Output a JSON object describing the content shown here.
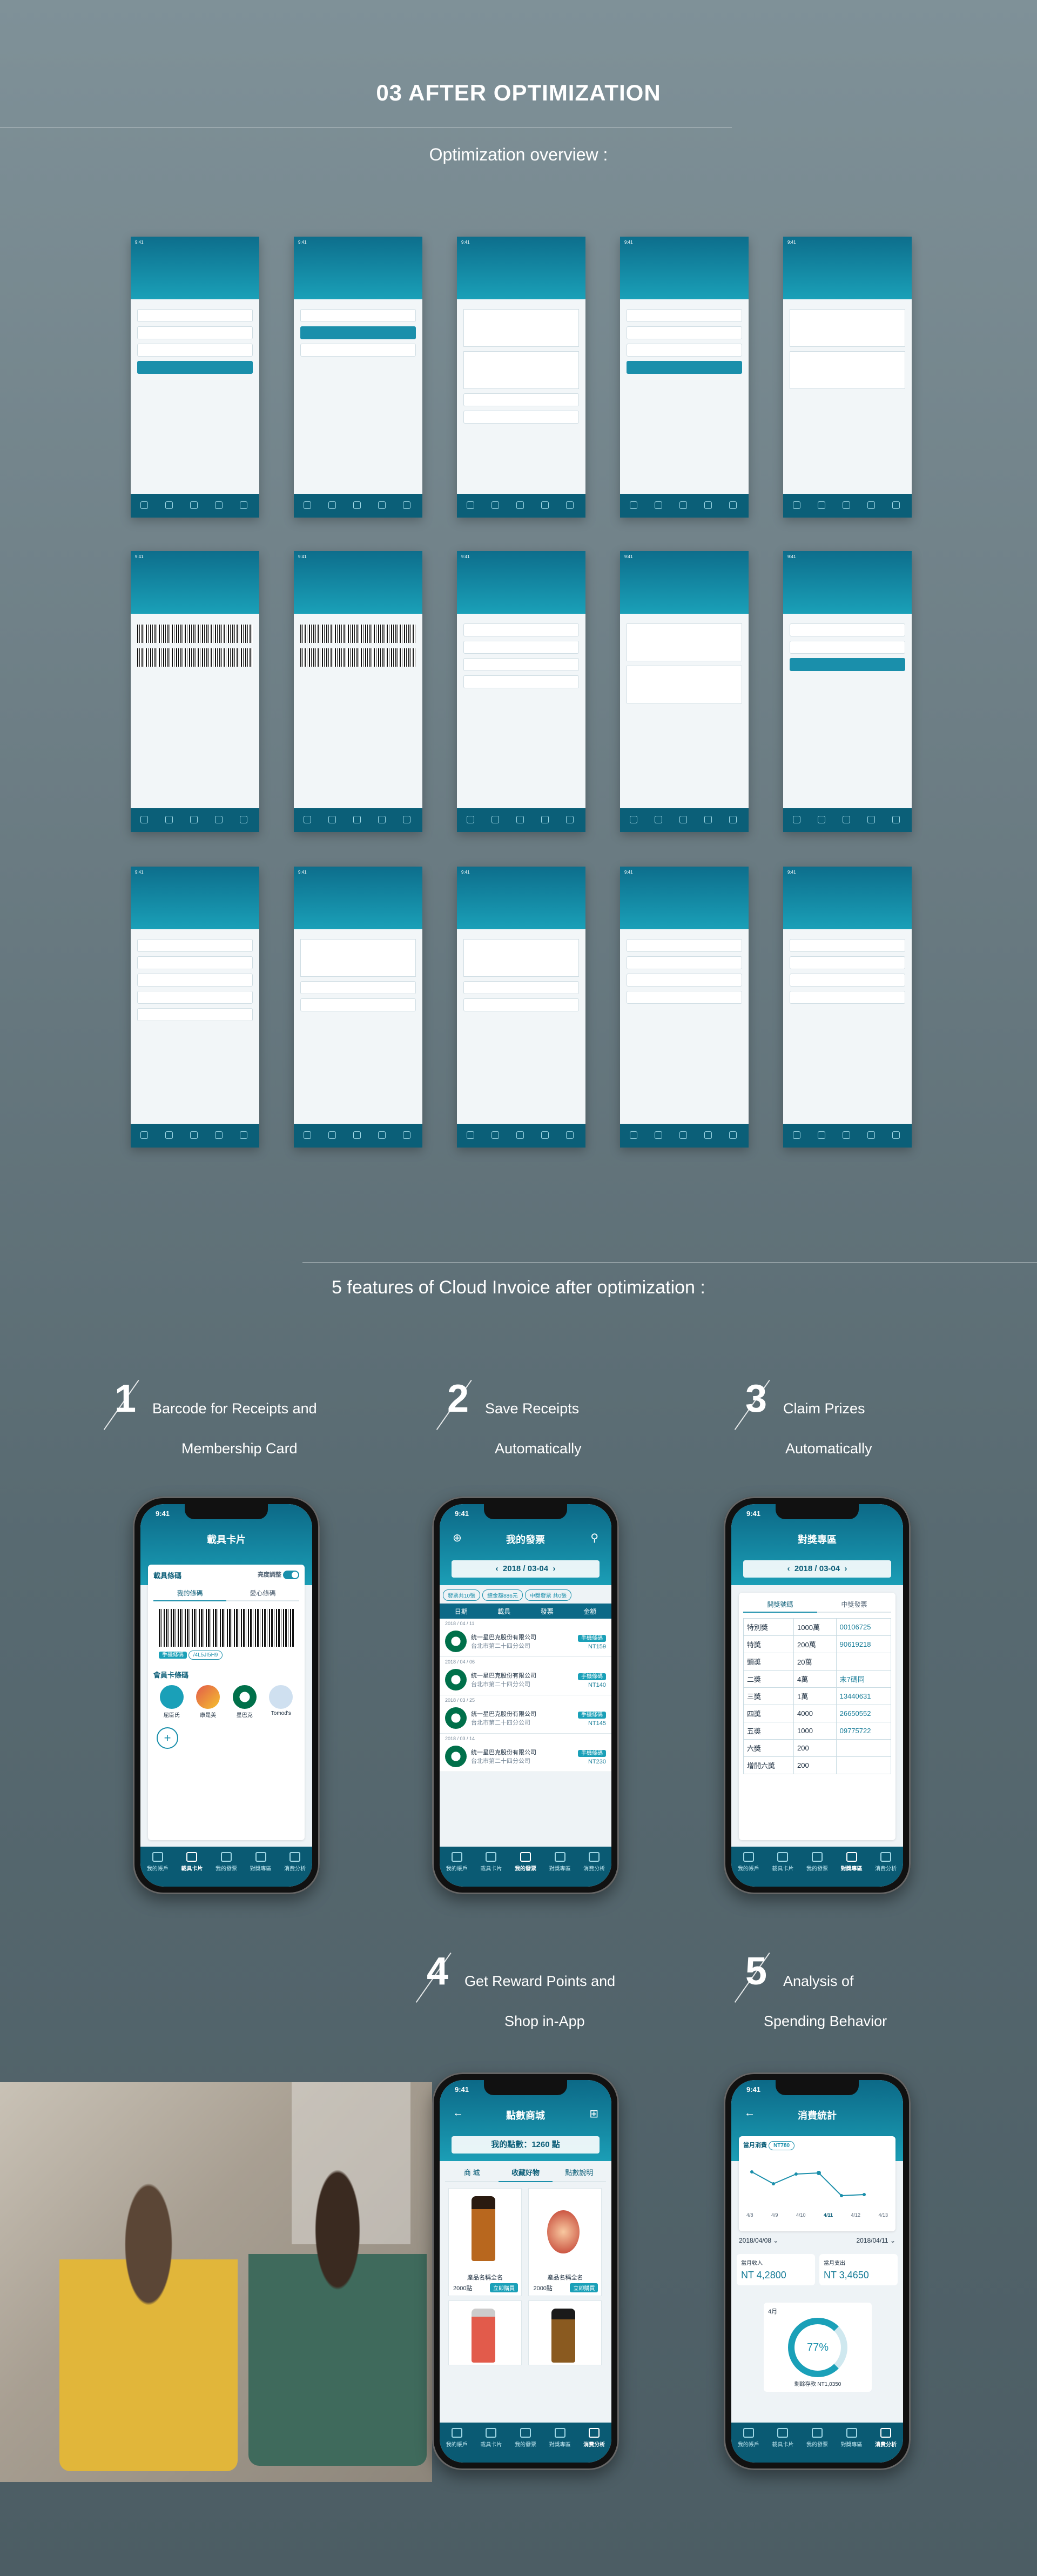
{
  "page": {
    "title": "03 AFTER OPTIMIZATION",
    "overview_label": "Optimization overview :",
    "features_heading": "5 features of Cloud Invoice after optimization :"
  },
  "features": [
    {
      "num": "1",
      "line1": "Barcode for Receipts and",
      "line2": "Membership Card"
    },
    {
      "num": "2",
      "line1": "Save Receipts",
      "line2": "Automatically"
    },
    {
      "num": "3",
      "line1": "Claim Prizes",
      "line2": "Automatically"
    },
    {
      "num": "4",
      "line1": "Get Reward Points and",
      "line2": "Shop  in-App"
    },
    {
      "num": "5",
      "line1": "Analysis of",
      "line2": "Spending Behavior"
    }
  ],
  "status_time": "9:41",
  "tabbar": [
    "我的帳戶",
    "載具卡片",
    "我的發票",
    "對獎專區",
    "消費分析"
  ],
  "phone1": {
    "title": "載具卡片",
    "carrier_label": "載具條碼",
    "toggle_label": "亮度調整",
    "tabs": [
      "我的條碼",
      "愛心條碼"
    ],
    "barcode_code": "/4L5JI5H9",
    "barcode_tag": "手機條碼",
    "cards_label": "會員卡條碼",
    "cards": [
      "屈臣氏",
      "康是美",
      "星巴克",
      "Tomod's"
    ]
  },
  "phone2": {
    "title": "我的發票",
    "date": "2018 / 03-04",
    "chips": [
      "發票共10張",
      "總金額886元",
      "中獎發票 共0張"
    ],
    "cols": [
      "日期",
      "載具",
      "發票",
      "金額"
    ],
    "records": [
      {
        "date": "2018 / 04 / 11",
        "store": "統一星巴克股份有限公司",
        "addr": "台北市第二十四分公司",
        "type": "手機條碼",
        "amount": "NT159"
      },
      {
        "date": "2018 / 04 / 06",
        "store": "統一星巴克股份有限公司",
        "addr": "台北市第二十四分公司",
        "type": "手機條碼",
        "amount": "NT140"
      },
      {
        "date": "2018 / 03 / 25",
        "store": "統一星巴克股份有限公司",
        "addr": "台北市第二十四分公司",
        "type": "手機條碼",
        "amount": "NT145"
      },
      {
        "date": "2018 / 03 / 14",
        "store": "統一星巴克股份有限公司",
        "addr": "台北市第二十四分公司",
        "type": "手機條碼",
        "amount": "NT230"
      }
    ]
  },
  "phone3": {
    "title": "對獎專區",
    "date": "2018 / 03-04",
    "tabs": [
      "開獎號碼",
      "中獎發票"
    ],
    "rows": [
      {
        "name": "特別獎",
        "amount": "1000萬",
        "num": "00106725"
      },
      {
        "name": "特獎",
        "amount": "200萬",
        "num": "90619218"
      },
      {
        "name": "頭獎",
        "amount": "20萬",
        "num": ""
      },
      {
        "name": "二獎",
        "amount": "4萬",
        "num": "末7碼同"
      },
      {
        "name": "三獎",
        "amount": "1萬",
        "num": "13440631"
      },
      {
        "name": "四獎",
        "amount": "4000",
        "num": "26650552"
      },
      {
        "name": "五獎",
        "amount": "1000",
        "num": "09775722"
      },
      {
        "name": "六獎",
        "amount": "200",
        "num": ""
      },
      {
        "name": "增開六獎",
        "amount": "200",
        "num": ""
      }
    ]
  },
  "phone4": {
    "title": "點數商城",
    "points": "我的點數：1260 點",
    "tabs": [
      "商 城",
      "收藏好物",
      "點數說明"
    ],
    "products": [
      {
        "name": "產品名稱全名",
        "price": "2000點",
        "btn": "立即購買"
      },
      {
        "name": "產品名稱全名",
        "price": "2000點",
        "btn": "立即購買"
      }
    ]
  },
  "phone5": {
    "title": "消費統計",
    "month_label": "當月消費",
    "peak": "NT780",
    "x_labels": [
      "4/8",
      "4/9",
      "4/10",
      "4/11",
      "4/12",
      "4/13"
    ],
    "date_from": "2018/04/08",
    "date_to": "2018/04/11",
    "income_label": "當月收入",
    "income": "NT 4,2800",
    "expense_label": "當月支出",
    "expense": "NT 3,4650",
    "ring_month": "4月",
    "ring_value": "77%",
    "saving": "剩餘存款 NT1,0350"
  },
  "colors": {
    "brand": "#1a8fab",
    "brand_dark": "#0a5a73",
    "accent_yellow": "#f5c12e",
    "accent_red": "#e25b4b"
  }
}
